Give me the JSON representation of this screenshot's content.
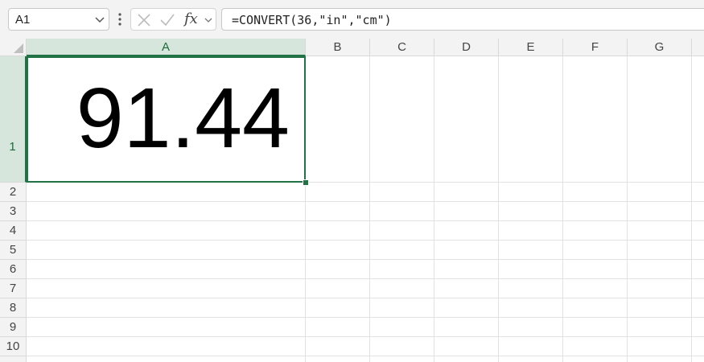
{
  "formula_bar": {
    "name_box": "A1",
    "fx_label": "fx",
    "formula": "=CONVERT(36,\"in\",\"cm\")",
    "icons": [
      "chevron-down-icon",
      "more-dots-icon",
      "cancel-icon",
      "enter-icon",
      "chevron-down-icon"
    ]
  },
  "sheet": {
    "columns": [
      "A",
      "B",
      "C",
      "D",
      "E",
      "F",
      "G"
    ],
    "rows": [
      "1",
      "2",
      "3",
      "4",
      "5",
      "6",
      "7",
      "8",
      "9",
      "10"
    ],
    "active_cell": "A1",
    "cells": {
      "A1": "91.44"
    }
  },
  "colors": {
    "accent": "#217346",
    "header_bg": "#f3f3f3",
    "active_header_bg": "#d6e6dc",
    "gridline": "#e1e1e1"
  }
}
